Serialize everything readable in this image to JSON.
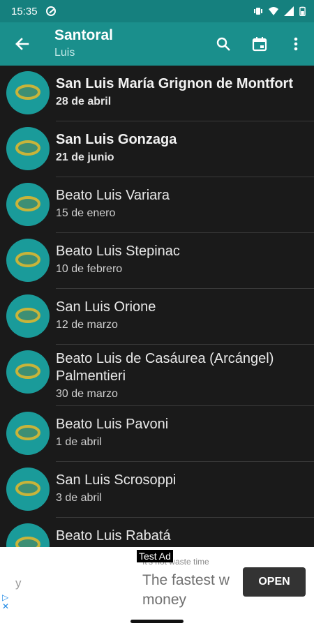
{
  "status_bar": {
    "time": "15:35"
  },
  "app_bar": {
    "title": "Santoral",
    "subtitle": "Luis"
  },
  "saints": [
    {
      "name": "San Luis María Grignon de Montfort",
      "date": "28 de abril",
      "bold": true
    },
    {
      "name": "San Luis Gonzaga",
      "date": "21 de junio",
      "bold": true
    },
    {
      "name": "Beato Luis Variara",
      "date": "15 de enero",
      "bold": false
    },
    {
      "name": "Beato Luis Stepinac",
      "date": "10 de febrero",
      "bold": false
    },
    {
      "name": "San Luis Orione",
      "date": "12 de marzo",
      "bold": false
    },
    {
      "name": "Beato Luis de Casáurea (Arcángel) Palmentieri",
      "date": "30 de marzo",
      "bold": false
    },
    {
      "name": "Beato Luis Pavoni",
      "date": "1 de abril",
      "bold": false
    },
    {
      "name": "San Luis Scrosoppi",
      "date": "3 de abril",
      "bold": false
    },
    {
      "name": "Beato Luis Rabatá",
      "date": "",
      "bold": false
    }
  ],
  "ad": {
    "tag": "Test Ad",
    "small_text": "It's not waste time",
    "left_letter": "y",
    "headline": "The fastest w money",
    "button": "OPEN",
    "choices": "▷\n✕"
  },
  "colors": {
    "app_bar": "#1a8f8c",
    "status_bar": "#15807e",
    "avatar": "#1a9b9a",
    "background": "#1a1a1a"
  }
}
